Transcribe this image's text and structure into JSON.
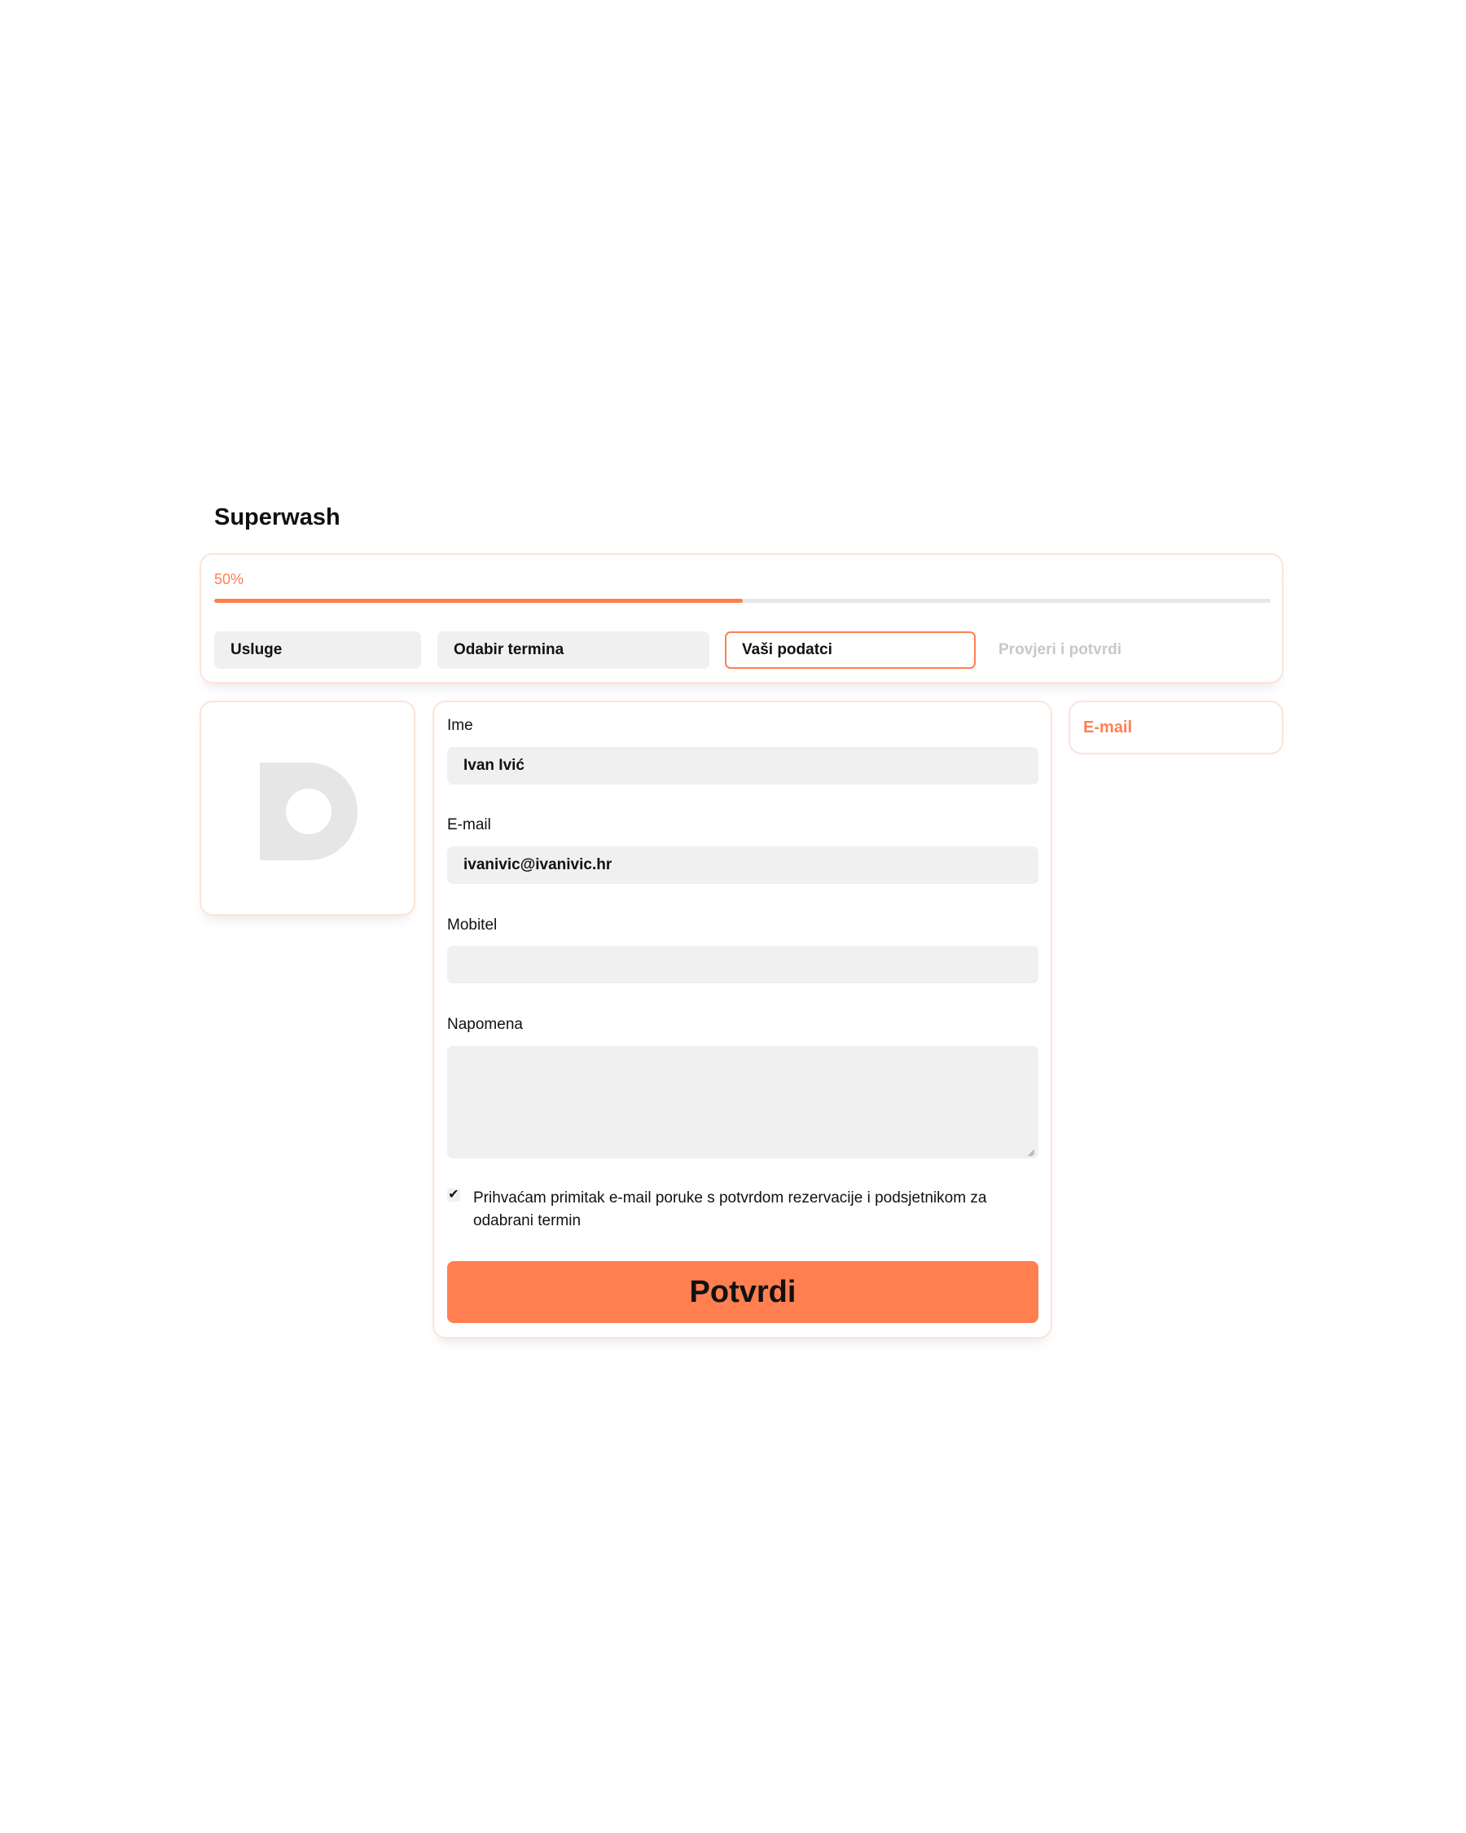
{
  "header": {
    "title": "Superwash"
  },
  "progress": {
    "label": "50%",
    "value": 0.5,
    "steps": [
      {
        "label": "Usluge",
        "state": "completed"
      },
      {
        "label": "Odabir termina",
        "state": "completed"
      },
      {
        "label": "Vaši podatci",
        "state": "active"
      },
      {
        "label": "Provjeri i potvrdi",
        "state": "upcoming"
      }
    ]
  },
  "form": {
    "name": {
      "label": "Ime",
      "value": "Ivan Ivić"
    },
    "email": {
      "label": "E-mail",
      "value": "ivanivic@ivanivic.hr"
    },
    "mobile": {
      "label": "Mobitel",
      "value": ""
    },
    "note": {
      "label": "Napomena",
      "value": ""
    },
    "consent": {
      "checked": true,
      "text": "Prihvaćam primitak e-mail poruke s potvrdom rezervacije i podsjetnikom za odabrani termin"
    },
    "submit_label": "Potvrdi"
  },
  "side": {
    "contact_label": "E-mail"
  },
  "icons": {
    "logo": "d-logo-icon",
    "check": "check-icon",
    "resize": "resize-grip-icon"
  },
  "colors": {
    "accent": "#ff7f50",
    "border": "#fde3da",
    "field_bg": "#f0f0f0",
    "muted": "#c8c8c8"
  }
}
